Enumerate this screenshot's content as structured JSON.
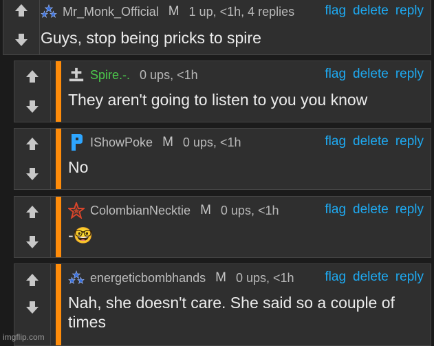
{
  "comments": [
    {
      "username": "Mr_Monk_Official",
      "mod_badge": "M",
      "stats": "1 up, <1h, 4 replies",
      "text": "Guys, stop being pricks to spire",
      "avatar_icon": "stars-icon",
      "username_color": "#bdbdbd"
    },
    {
      "username": "Spire.-.",
      "mod_badge": "",
      "stats": "0 ups, <1h",
      "text": "They aren't going to listen to you you know",
      "avatar_icon": "grave-cross-icon",
      "username_color": "#4cc94c"
    },
    {
      "username": "IShowPoke",
      "mod_badge": "M",
      "stats": "0 ups, <1h",
      "text": "No",
      "avatar_icon": "blue-p-icon",
      "username_color": "#bdbdbd"
    },
    {
      "username": "ColombianNecktie",
      "mod_badge": "M",
      "stats": "0 ups, <1h",
      "text": "-🤓",
      "avatar_icon": "red-star-icon",
      "username_color": "#bdbdbd"
    },
    {
      "username": "energeticbombhands",
      "mod_badge": "M",
      "stats": "0 ups, <1h",
      "text": "Nah, she doesn't care. She said so a couple of times",
      "avatar_icon": "stars-icon",
      "username_color": "#bdbdbd"
    }
  ],
  "actions": {
    "flag": "flag",
    "delete": "delete",
    "reply": "reply"
  },
  "footer": "imgflip.com",
  "colors": {
    "accent": "#ff8c0a",
    "link": "#1eaaf2",
    "panel": "#2f2f2f",
    "background": "#1b1b1b"
  }
}
